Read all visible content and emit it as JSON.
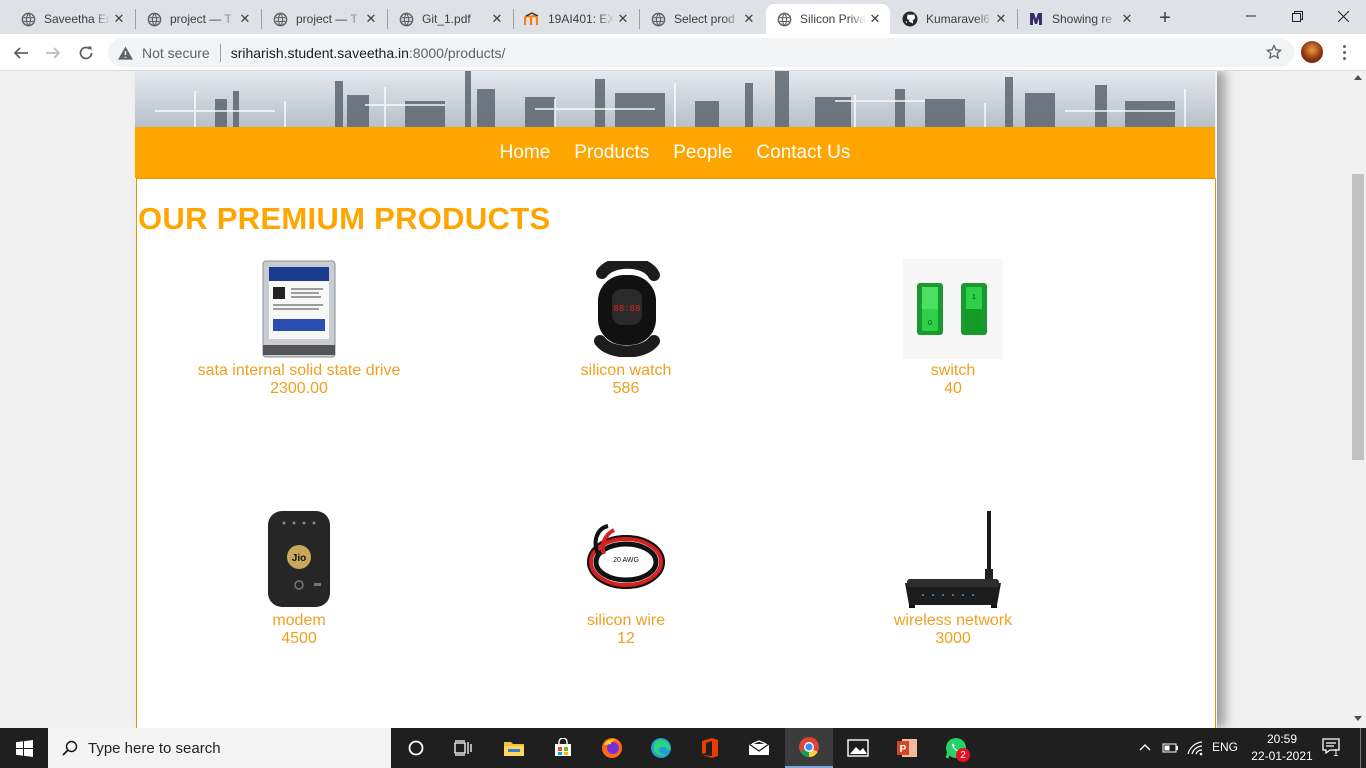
{
  "browser": {
    "tabs": [
      {
        "title": "Saveetha Er",
        "icon": "globe-icon"
      },
      {
        "title": "project — T",
        "icon": "globe-icon"
      },
      {
        "title": "project — T",
        "icon": "globe-icon"
      },
      {
        "title": "Git_1.pdf",
        "icon": "globe-icon"
      },
      {
        "title": "19AI401: EX",
        "icon": "moodle-icon"
      },
      {
        "title": "Select prod",
        "icon": "globe-icon"
      },
      {
        "title": "Silicon Priva",
        "icon": "globe-icon",
        "active": true
      },
      {
        "title": "Kumaravel6",
        "icon": "github-icon"
      },
      {
        "title": "Showing re",
        "icon": "university-icon"
      }
    ],
    "not_secure": "Not secure",
    "url_host": "sriharish.student.saveetha.in",
    "url_rest": ":8000/products/"
  },
  "site": {
    "nav": [
      "Home",
      "Products",
      "People",
      "Contact Us"
    ],
    "heading": "OUR PREMIUM PRODUCTS",
    "accent": "#ffa500",
    "products": [
      {
        "name": "sata internal solid state drive",
        "price": "2300.00",
        "icon": "hard-drive-icon"
      },
      {
        "name": "silicon watch",
        "price": "586",
        "icon": "smart-band-icon"
      },
      {
        "name": "switch",
        "price": "40",
        "icon": "switch-icon"
      },
      {
        "name": "modem",
        "price": "4500",
        "icon": "modem-icon"
      },
      {
        "name": "silicon wire",
        "price": "12",
        "icon": "wire-icon"
      },
      {
        "name": "wireless network",
        "price": "3000",
        "icon": "router-icon"
      }
    ]
  },
  "taskbar": {
    "search_placeholder": "Type here to search",
    "lang": "ENG",
    "time": "20:59",
    "date": "22-01-2021",
    "notifications": "1",
    "whatsapp_badge": "2"
  }
}
